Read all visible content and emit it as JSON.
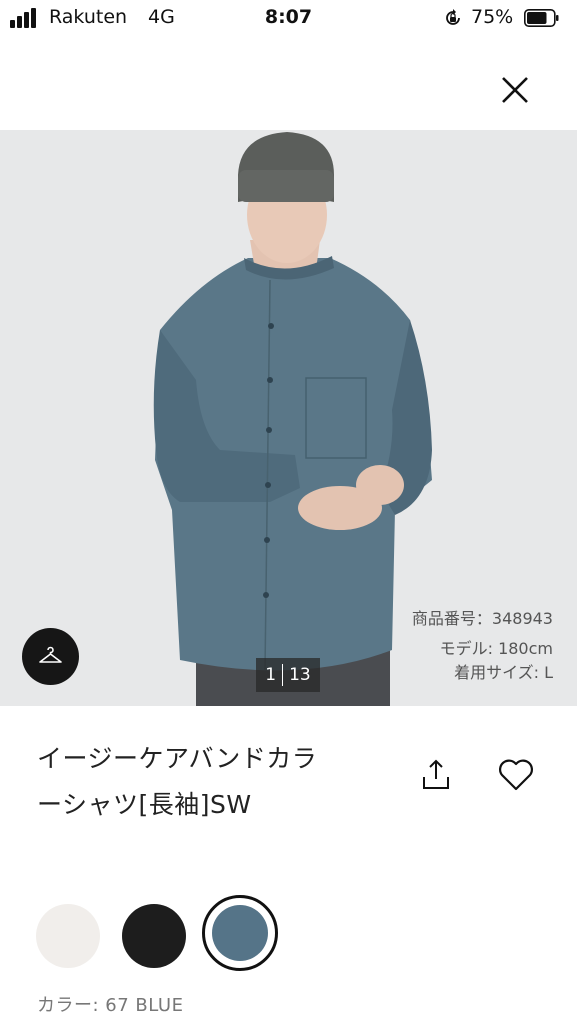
{
  "status_bar": {
    "carrier": "Rakuten",
    "network": "4G",
    "time": "8:07",
    "battery_percent": "75%",
    "battery_level": 0.75
  },
  "product": {
    "title_line1": "イージーケアバンドカラ",
    "title_line2": "ーシャツ[長袖]SW",
    "product_number": "商品番号：348943",
    "model_height": "モデル: 180cm",
    "worn_size": "着用サイズ: L",
    "image_current": "1",
    "image_total": "13"
  },
  "colors": {
    "label": "カラー: 67 BLUE",
    "swatches": [
      {
        "name": "white",
        "hex": "#f1eeeb"
      },
      {
        "name": "black",
        "hex": "#1d1d1d"
      },
      {
        "name": "blue",
        "hex": "#557488",
        "selected": true
      }
    ]
  },
  "icons": {
    "close": "close-icon",
    "hanger": "hanger-icon",
    "share": "share-icon",
    "favorite": "heart-icon"
  }
}
